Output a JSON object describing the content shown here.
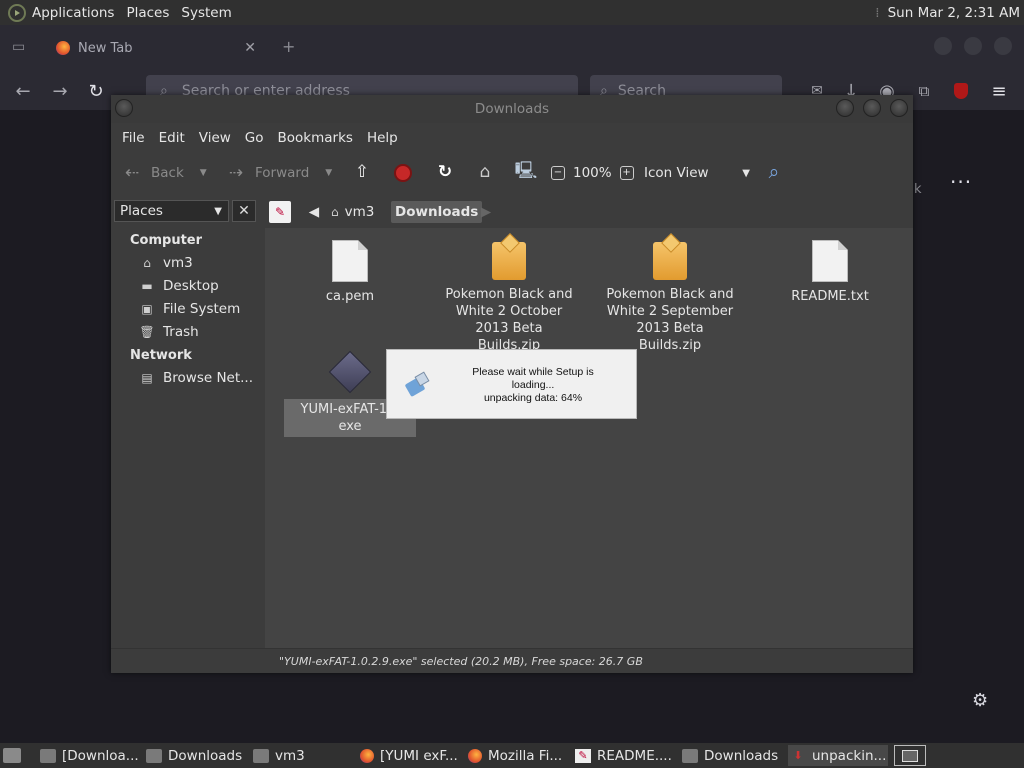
{
  "top_panel": {
    "menus": [
      "Applications",
      "Places",
      "System"
    ],
    "clock": "Sun Mar 2,  2:31 AM"
  },
  "firefox": {
    "tab_label": "New Tab",
    "url_placeholder": "Search or enter address",
    "search_placeholder": "Search",
    "partial_text": "k"
  },
  "window": {
    "title": "Downloads",
    "menus": [
      "File",
      "Edit",
      "View",
      "Go",
      "Bookmarks",
      "Help"
    ],
    "toolbar": {
      "back": "Back",
      "forward": "Forward",
      "zoom": "100%",
      "view_mode": "Icon View"
    },
    "sidebar": {
      "selector": "Places",
      "computer_heading": "Computer",
      "computer_items": [
        "vm3",
        "Desktop",
        "File System",
        "Trash"
      ],
      "network_heading": "Network",
      "network_items": [
        "Browse Net..."
      ]
    },
    "path": [
      "vm3",
      "Downloads"
    ],
    "files": [
      {
        "name": "ca.pem",
        "type": "document"
      },
      {
        "name": "Pokemon Black and White 2 October 2013 Beta Builds.zip",
        "type": "archive"
      },
      {
        "name": "Pokemon Black and White 2 September 2013 Beta Builds.zip",
        "type": "archive"
      },
      {
        "name": "README.txt",
        "type": "document"
      },
      {
        "name": "YUMI-exFAT-1.0 exe",
        "type": "executable",
        "selected": true
      }
    ],
    "status": "\"YUMI-exFAT-1.0.2.9.exe\" selected (20.2 MB), Free space: 26.7 GB"
  },
  "dialog": {
    "line1": "Please wait while Setup is",
    "line2": "loading...",
    "line3": "unpacking data: 64%",
    "progress_percent": 64
  },
  "taskbar": {
    "items": [
      {
        "label": "[Downloa...",
        "icon": "folder-icon"
      },
      {
        "label": "Downloads",
        "icon": "folder-icon"
      },
      {
        "label": "vm3",
        "icon": "folder-icon"
      },
      {
        "label": "[YUMI exF...",
        "icon": "firefox-icon"
      },
      {
        "label": "Mozilla Fi...",
        "icon": "firefox-icon"
      },
      {
        "label": "README....",
        "icon": "text-editor-icon"
      },
      {
        "label": "Downloads",
        "icon": "folder-icon"
      },
      {
        "label": "unpackin...",
        "icon": "installer-icon"
      }
    ]
  }
}
